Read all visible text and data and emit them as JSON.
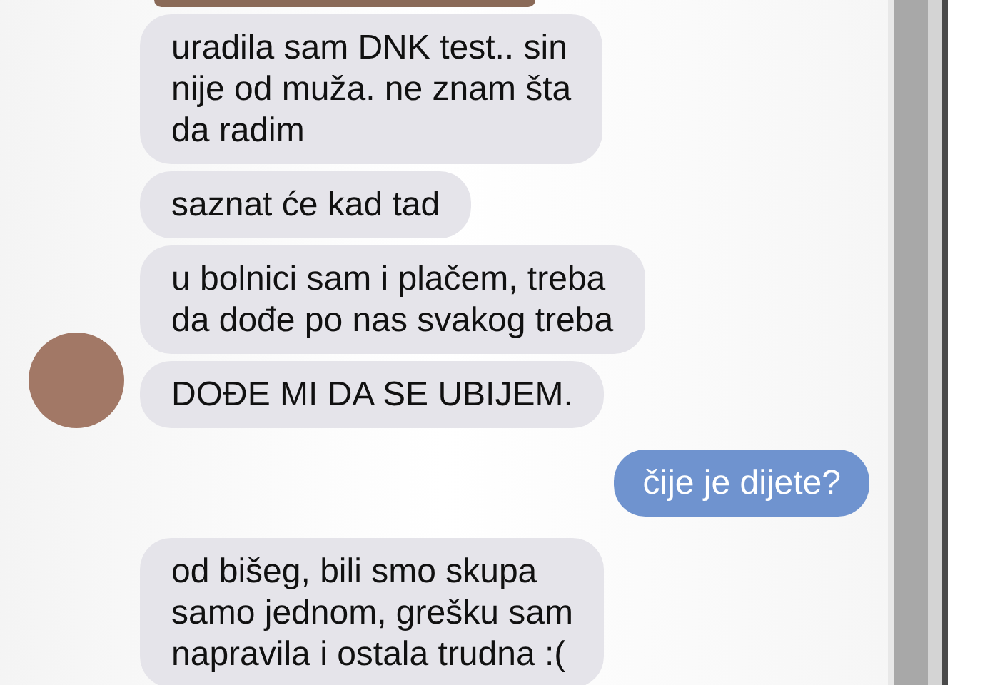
{
  "messages": [
    {
      "kind": "photo"
    },
    {
      "kind": "received",
      "lines": [
        "uradila sam DNK test.. sin",
        "nije od muža. ne znam šta",
        "da radim"
      ],
      "avatar": false
    },
    {
      "kind": "received",
      "lines": [
        "saznat će kad tad"
      ],
      "avatar": false
    },
    {
      "kind": "received",
      "lines": [
        "u bolnici sam i plačem, treba",
        "da dođe po nas svakog treba"
      ],
      "avatar": false
    },
    {
      "kind": "received",
      "lines": [
        "DOĐE MI DA SE UBIJEM."
      ],
      "avatar": true
    },
    {
      "kind": "sent",
      "lines": [
        "čije je dijete?"
      ]
    },
    {
      "kind": "received",
      "lines": [
        "od bišeg, bili smo skupa",
        "samo jednom, grešku sam",
        "napravila i ostala trudna :("
      ],
      "avatar": false
    }
  ]
}
